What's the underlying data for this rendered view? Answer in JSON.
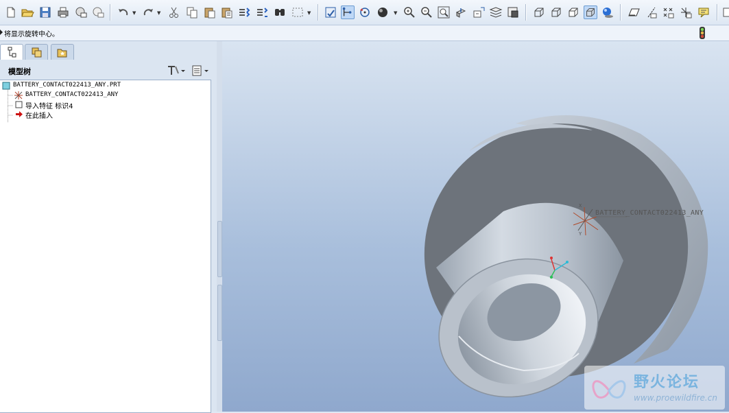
{
  "toolbar": {
    "buttons": [
      "new-file",
      "open-file",
      "save",
      "print",
      "send-email",
      "send-link",
      "undo",
      "redo",
      "cut",
      "copy",
      "paste",
      "paste-special",
      "regenerate",
      "regenerate-manager",
      "find",
      "select-box",
      "repaint",
      "spin-center",
      "orientation-mode",
      "shading",
      "zoom-in",
      "zoom-out",
      "refit",
      "named-view",
      "view-manager",
      "layers",
      "appearance",
      "wireframe",
      "hidden-line",
      "no-hidden",
      "shaded",
      "enhanced-realism",
      "plane-display",
      "axis-display",
      "point-display",
      "csys-display",
      "annotation-display"
    ]
  },
  "message_bar": {
    "text": "将显示旋转中心。"
  },
  "panel": {
    "tabs": [
      "model-tree",
      "folder-browser",
      "favorites"
    ],
    "title": "模型树",
    "tree": {
      "root": "BATTERY_CONTACT022413_ANY.PRT",
      "items": [
        "BATTERY_CONTACT022413_ANY",
        "导入特征 标识4",
        "在此插入"
      ]
    }
  },
  "viewport": {
    "csys_label": "BATTERY_CONTACT022413_ANY",
    "watermark_title": "野火论坛",
    "watermark_url": "www.proewildfire.cn"
  },
  "colors": {
    "viewport_top": "#d9e4f1",
    "viewport_bottom": "#8fa8cd",
    "model_face": "#6d737b",
    "model_light": "#c4ccd6",
    "insert_arrow": "#cc1111"
  }
}
